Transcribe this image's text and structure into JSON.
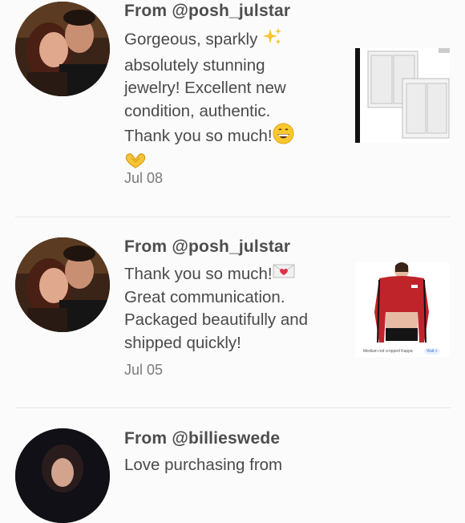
{
  "reviews": [
    {
      "from": "From @posh_julstar",
      "lines": [
        "Gorgeous, sparkly",
        "absolutely stunning",
        "jewelry! Excellent new",
        "condition, authentic.",
        "Thank you so much!"
      ],
      "emojis": [
        "sparkles-icon",
        "grinning-face-icon",
        "heart-hands-icon"
      ],
      "date": "Jul 08",
      "thumb": "white-cabinet-listing-image"
    },
    {
      "from": "From @posh_julstar",
      "lines": [
        "Thank you so much!",
        "Great communication.",
        "Packaged beautifully and",
        "shipped quickly!"
      ],
      "emojis": [
        "love-letter-icon"
      ],
      "date": "Jul 05",
      "thumb": "red-sweater-listing-image",
      "thumb_caption": "Medium red cropped Kappa",
      "thumb_visit": "Visit >"
    },
    {
      "from": "From @billieswede",
      "lines": [
        "Love purchasing from"
      ]
    }
  ]
}
